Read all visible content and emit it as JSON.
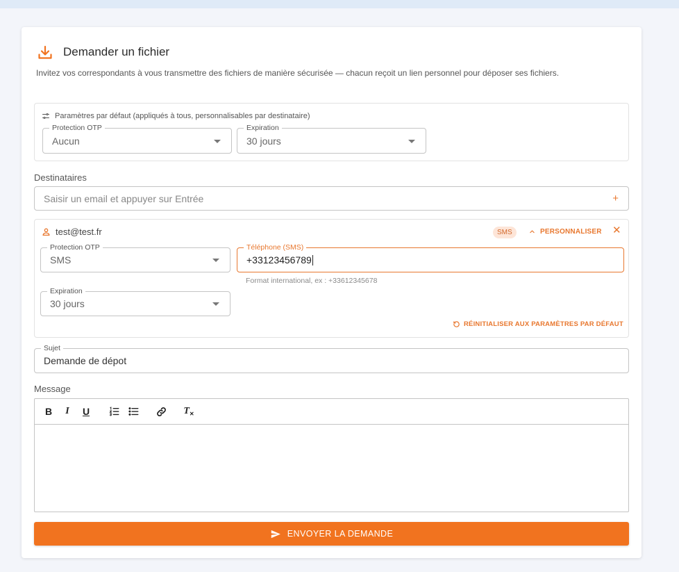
{
  "header": {
    "title": "Demander un fichier",
    "description": "Invitez vos correspondants à vous transmettre des fichiers de manière sécurisée — chacun reçoit un lien personnel pour déposer ses fichiers."
  },
  "defaults": {
    "label": "Paramètres par défaut (appliqués à tous, personnalisables par destinataire)",
    "otp": {
      "label": "Protection OTP",
      "value": "Aucun"
    },
    "expiration": {
      "label": "Expiration",
      "value": "30 jours"
    }
  },
  "recipients": {
    "label": "Destinataires",
    "input_placeholder": "Saisir un email et appuyer sur Entrée",
    "add_symbol": "+",
    "items": [
      {
        "email": "test@test.fr",
        "badge": "SMS",
        "customize_label": "PERSONNALISER",
        "remove_symbol": "✕",
        "otp": {
          "label": "Protection OTP",
          "value": "SMS"
        },
        "phone": {
          "label": "Téléphone (SMS)",
          "value": "+33123456789",
          "hint": "Format international, ex : +33612345678"
        },
        "expiration": {
          "label": "Expiration",
          "value": "30 jours"
        },
        "reset_label": "RÉINITIALISER AUX PARAMÈTRES PAR DÉFAUT"
      }
    ]
  },
  "subject": {
    "label": "Sujet",
    "value": "Demande de dépot"
  },
  "message": {
    "label": "Message",
    "toolbar": {
      "bold": "B",
      "italic": "I",
      "underline": "U",
      "clear": "T"
    },
    "content": ""
  },
  "submit": {
    "label": "ENVOYER LA DEMANDE"
  },
  "colors": {
    "accent": "#f1731f",
    "badge_bg": "#fde5d8",
    "page_bg": "#f3f5fa"
  },
  "icons": {
    "title": "download-icon",
    "defaults": "sliders-icon",
    "recipient": "user-icon",
    "customize": "chevron-up-icon",
    "reset": "reset-icon",
    "submit": "send-icon"
  }
}
